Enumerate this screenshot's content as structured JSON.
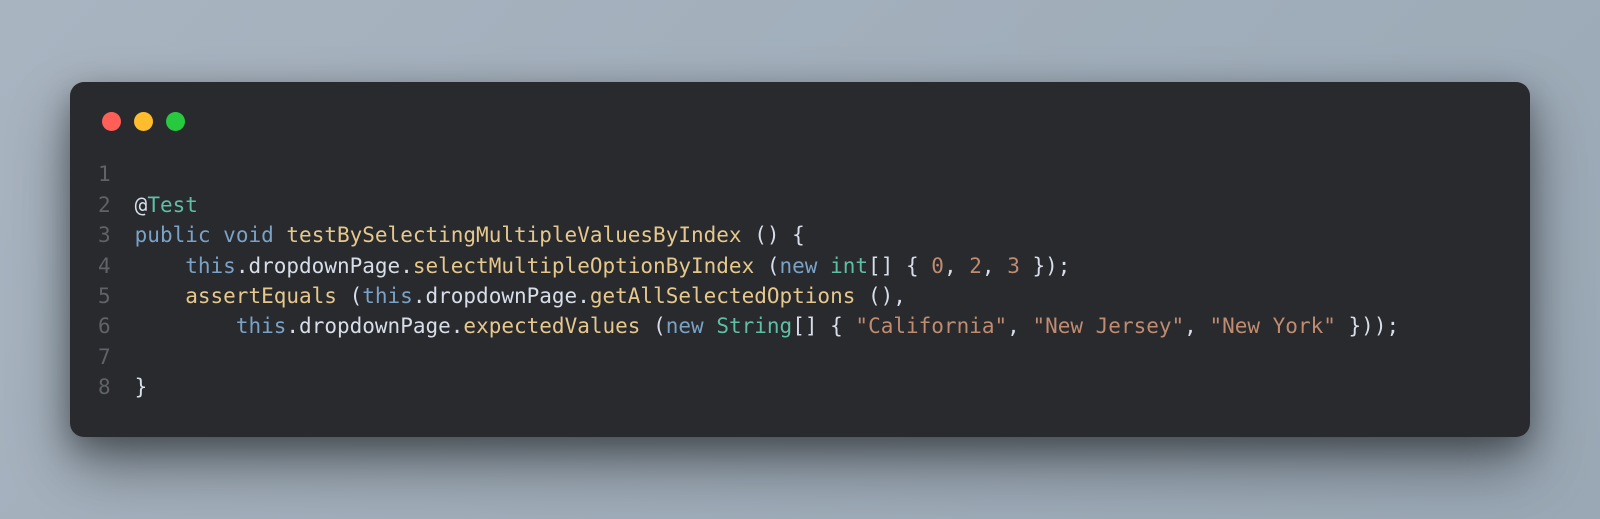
{
  "editor": {
    "line_numbers": [
      "1",
      "2",
      "3",
      "4",
      "5",
      "6",
      "7",
      "8"
    ],
    "line2": {
      "at": "@",
      "annot": "Test"
    },
    "line3": {
      "k_public": "public",
      "k_void": "void",
      "method": "testBySelectingMultipleValuesByIndex",
      "parens": " ()",
      "brace": " {"
    },
    "line4": {
      "indent": "    ",
      "this": "this",
      "dot1": ".",
      "prop1": "dropdownPage",
      "dot2": ".",
      "method": "selectMultipleOptionByIndex",
      "sp_open": " (",
      "new": "new",
      "sp": " ",
      "type": "int",
      "arr": "[]",
      "sp_brace": " { ",
      "n0": "0",
      "c1": ", ",
      "n1": "2",
      "c2": ", ",
      "n2": "3",
      "close": " });"
    },
    "line5": {
      "indent": "    ",
      "assert": "assertEquals",
      "sp_open": " (",
      "this": "this",
      "dot1": ".",
      "prop1": "dropdownPage",
      "dot2": ".",
      "method": "getAllSelectedOptions",
      "tail": " (),"
    },
    "line6": {
      "indent": "        ",
      "this": "this",
      "dot1": ".",
      "prop1": "dropdownPage",
      "dot2": ".",
      "method": "expectedValues",
      "sp_open": " (",
      "new": "new",
      "sp": " ",
      "type": "String",
      "arr": "[]",
      "sp_brace": " { ",
      "s0": "\"California\"",
      "c1": ", ",
      "s1": "\"New Jersey\"",
      "c2": ", ",
      "s2": "\"New York\"",
      "close": " }));"
    },
    "line8": {
      "brace": "}"
    }
  }
}
